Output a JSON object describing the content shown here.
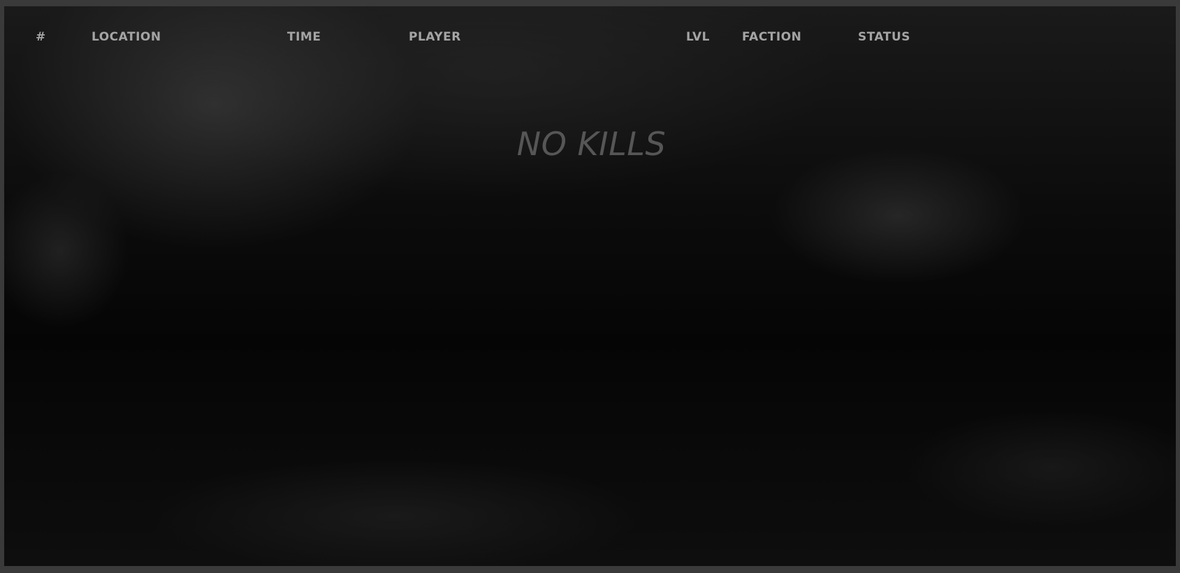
{
  "table": {
    "columns": [
      "#",
      "LOCATION",
      "TIME",
      "PLAYER",
      "LVL",
      "FACTION",
      "STATUS"
    ]
  },
  "empty_message": "NO KILLS",
  "colors": {
    "header_text": "#a4a4a4",
    "empty_text": "#565656",
    "background": "#0a0a0a",
    "frame": "#3a3a3a"
  }
}
